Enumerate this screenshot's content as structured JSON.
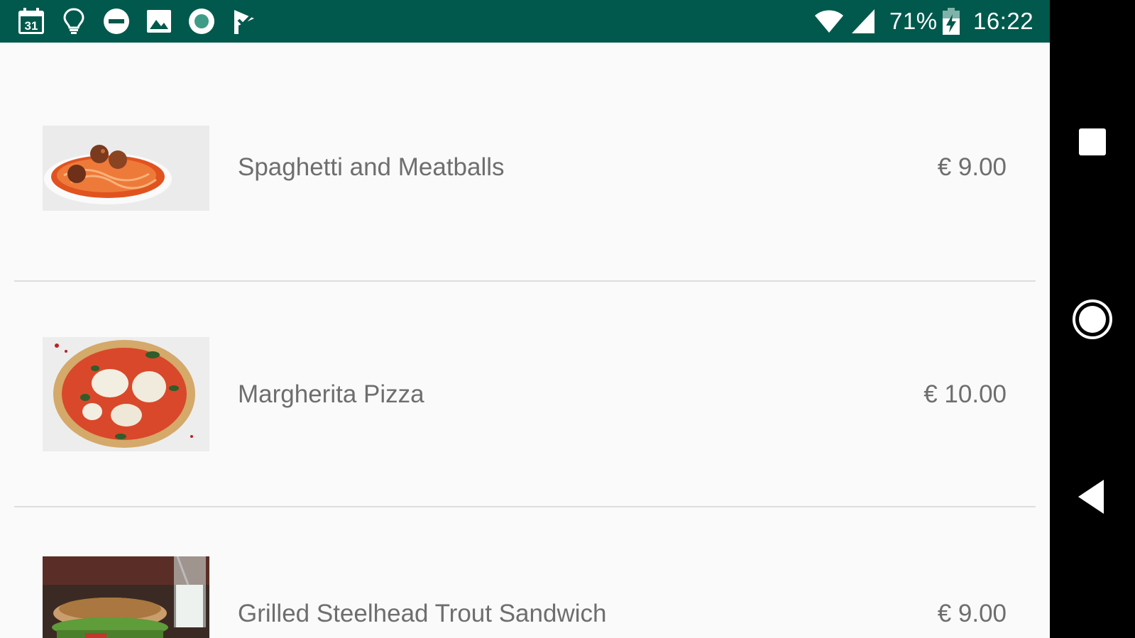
{
  "status_bar": {
    "background": "#00594c",
    "left_icons": [
      "calendar-icon",
      "lightbulb-icon",
      "do-not-disturb-icon",
      "image-icon",
      "record-icon",
      "check-flag-icon"
    ],
    "calendar_day": "31",
    "battery_percent": "71%",
    "time": "16:22"
  },
  "nav_bar": {
    "buttons": [
      "recents-button",
      "home-button",
      "back-button"
    ]
  },
  "menu": {
    "items": [
      {
        "name": "Spaghetti and Meatballs",
        "price": "€ 9.00",
        "image": "spaghetti-meatballs-photo"
      },
      {
        "name": "Margherita Pizza",
        "price": "€ 10.00",
        "image": "margherita-pizza-photo"
      },
      {
        "name": "Grilled Steelhead Trout Sandwich",
        "price": "€ 9.00",
        "image": "trout-sandwich-photo"
      }
    ]
  }
}
